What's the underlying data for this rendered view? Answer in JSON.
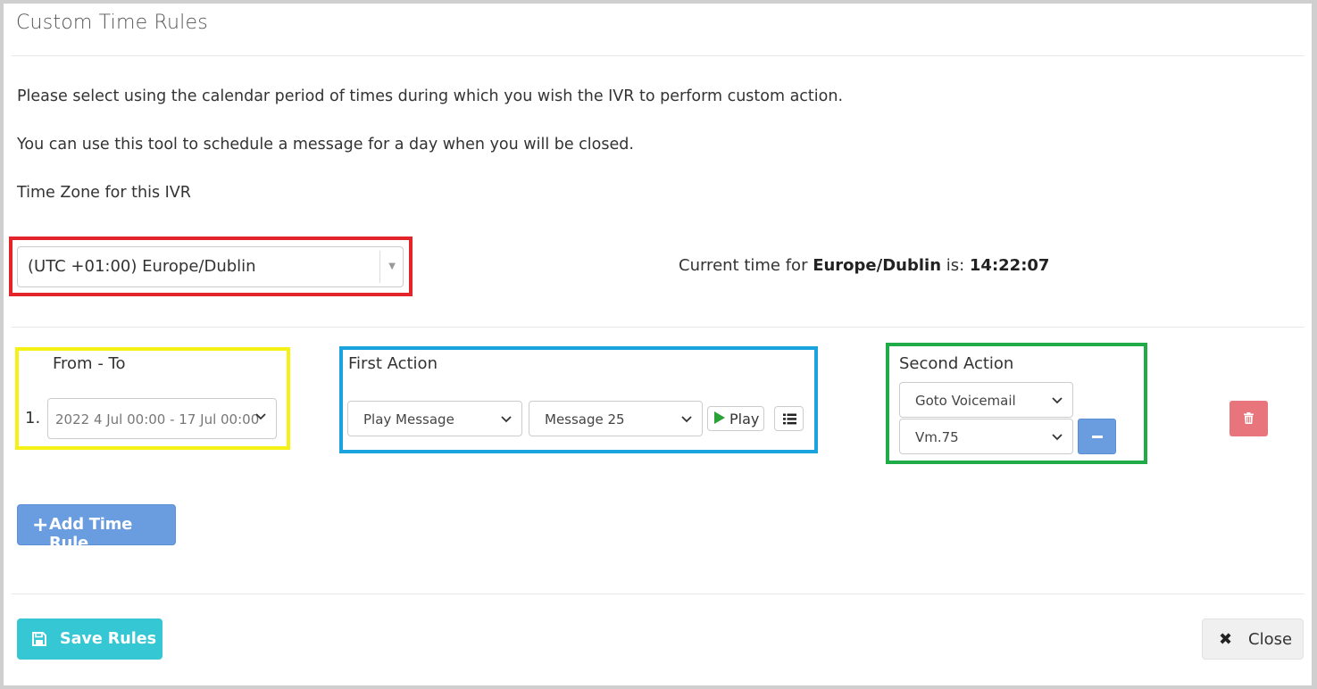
{
  "dialog": {
    "title": "Custom Time Rules",
    "intro_line_1": "Please select using the calendar period of times during which you wish the IVR to perform custom action.",
    "intro_line_2": "You can use this tool to schedule a message for a day when you will be closed.",
    "timezone_label": "Time Zone for this IVR"
  },
  "timezone": {
    "selected": "(UTC +01:00) Europe/Dublin",
    "current_time_prefix": "Current time for ",
    "zone_name": "Europe/Dublin",
    "current_time_mid": " is: ",
    "current_time": "14:22:07"
  },
  "rules": {
    "from_to_label": "From - To",
    "first_action_label": "First Action",
    "second_action_label": "Second Action",
    "items": [
      {
        "number": "1.",
        "date_range": "2022 4 Jul 00:00 - 17 Jul 00:00",
        "first_action": "Play Message",
        "first_action_target": "Message 25",
        "play_label": "Play",
        "second_action": "Goto Voicemail",
        "second_action_target": "Vm.75"
      }
    ]
  },
  "buttons": {
    "add_time_rule": "Add Time Rule",
    "save_rules": "Save Rules",
    "close": "Close"
  },
  "icons": {
    "add": "plus-icon",
    "save": "floppy-disk-icon",
    "close": "times-icon",
    "play": "play-icon",
    "list": "list-icon",
    "delete": "trash-icon",
    "remove": "minus-icon"
  },
  "colors": {
    "primary": "#6a9de0",
    "save": "#35c8d4",
    "danger": "#e8747c",
    "play_green": "#2ba238",
    "highlight_red": "#e3242b",
    "highlight_yellow": "#f6f115",
    "highlight_blue": "#1aa3df",
    "highlight_green": "#1fab48"
  }
}
